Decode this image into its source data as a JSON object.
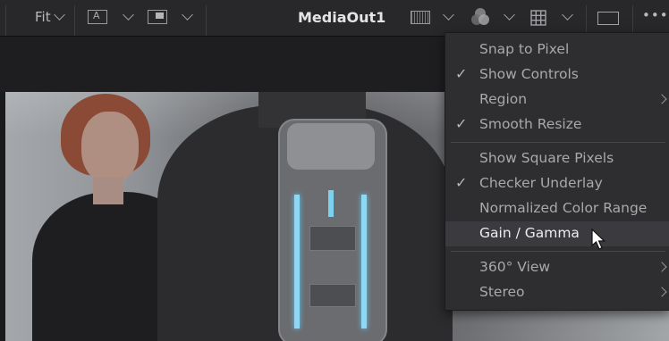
{
  "toolbar": {
    "fit_label": "Fit",
    "channel_label": "A",
    "title": "MediaOut1",
    "more_label": "•••"
  },
  "menu": {
    "groups": [
      [
        {
          "label": "Snap to Pixel",
          "checked": false,
          "submenu": false
        },
        {
          "label": "Show Controls",
          "checked": true,
          "submenu": false
        },
        {
          "label": "Region",
          "checked": false,
          "submenu": true
        },
        {
          "label": "Smooth Resize",
          "checked": true,
          "submenu": false
        }
      ],
      [
        {
          "label": "Show Square Pixels",
          "checked": false,
          "submenu": false
        },
        {
          "label": "Checker Underlay",
          "checked": true,
          "submenu": false
        },
        {
          "label": "Normalized Color Range",
          "checked": false,
          "submenu": false
        },
        {
          "label": "Gain / Gamma",
          "checked": false,
          "submenu": false,
          "highlighted": true
        }
      ],
      [
        {
          "label": "360° View",
          "checked": false,
          "submenu": true
        },
        {
          "label": "Stereo",
          "checked": false,
          "submenu": true
        }
      ]
    ],
    "check_glyph": "✓"
  },
  "icons": [
    "chevron-down-icon",
    "channel-icon",
    "display-icon",
    "color-wheel-icon",
    "grid-icon",
    "frame-icon",
    "more-icon",
    "mouse-cursor-icon",
    "submenu-arrow-icon"
  ],
  "colors": {
    "menu_bg": "#2e2e31",
    "highlight": "#3b3b3f",
    "toolbar_bg": "#28282b"
  }
}
